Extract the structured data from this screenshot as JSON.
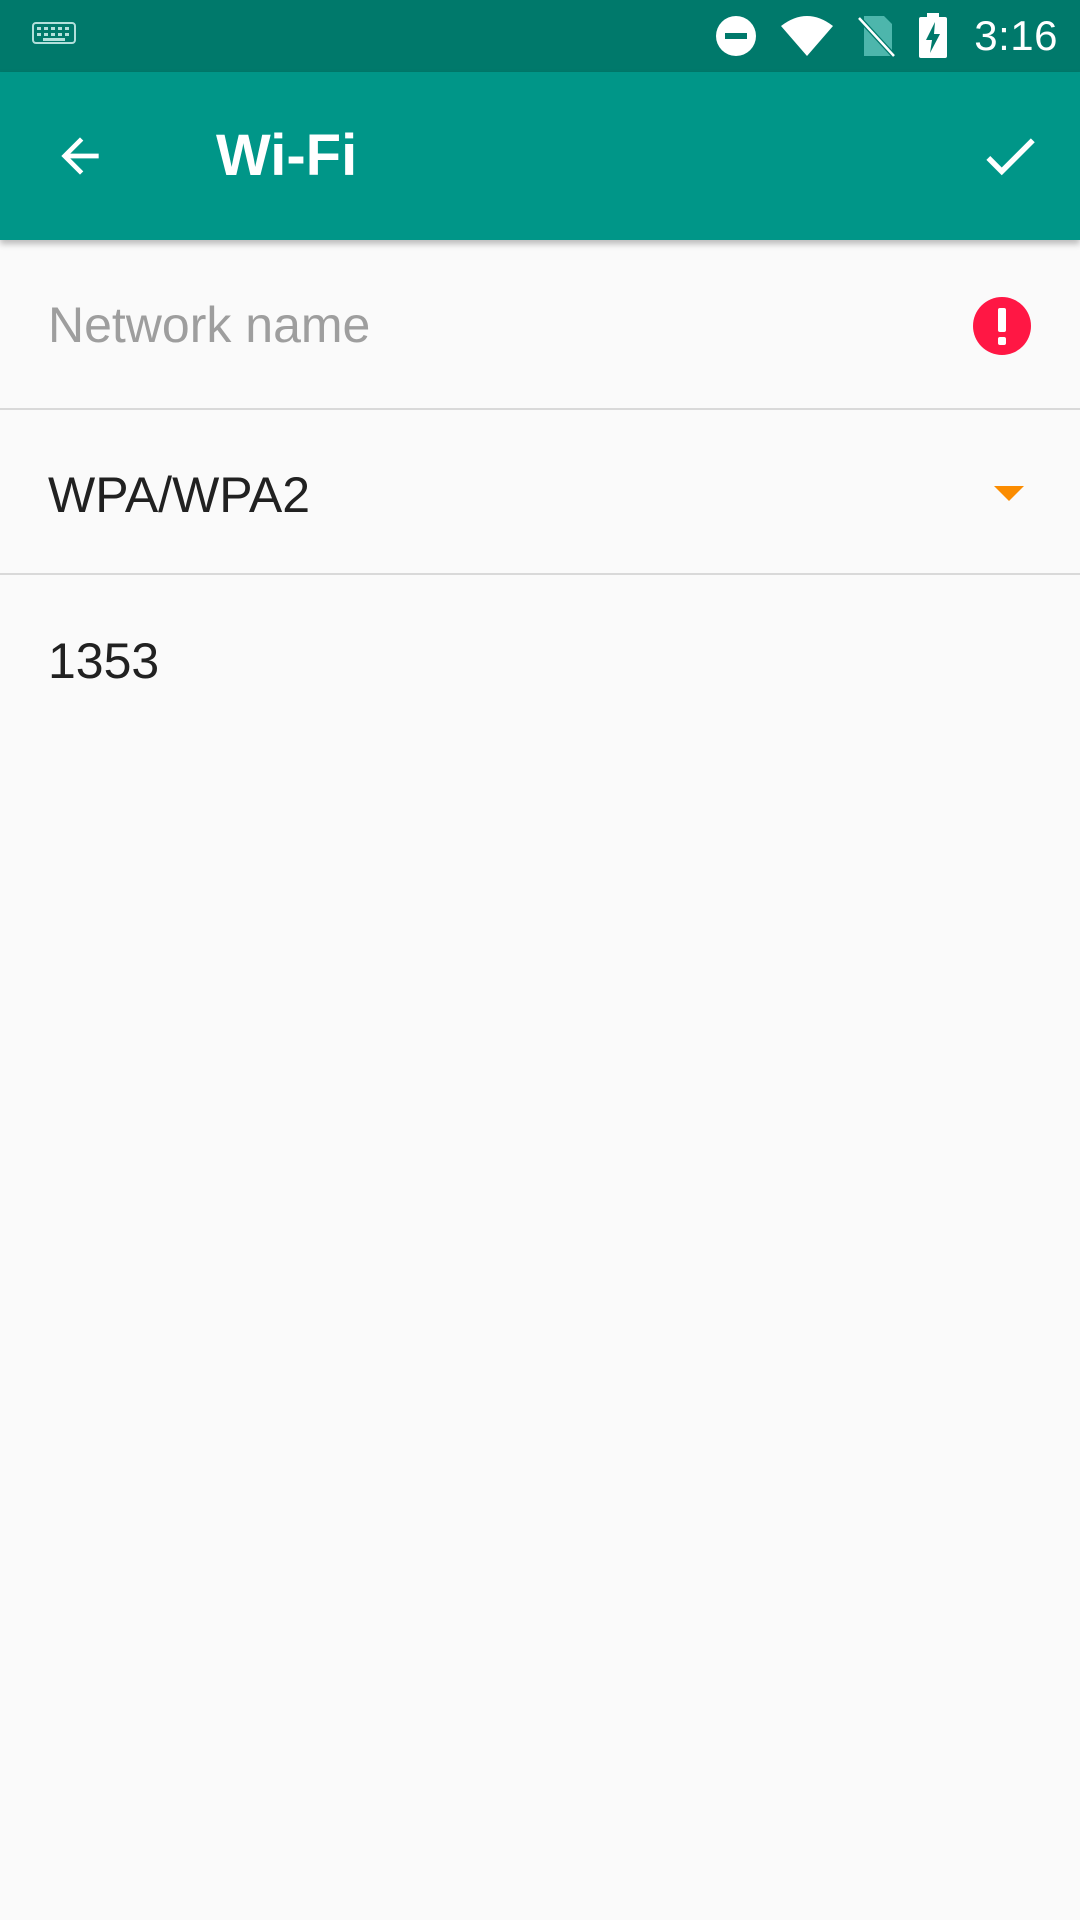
{
  "status_bar": {
    "time": "3:16",
    "icons": [
      "keyboard-icon",
      "do-not-disturb-icon",
      "wifi-icon",
      "no-sim-icon",
      "battery-charging-icon"
    ]
  },
  "app_bar": {
    "title": "Wi-Fi",
    "back_icon": "arrow-back-icon",
    "confirm_icon": "check-icon",
    "color": "#009688"
  },
  "form": {
    "network_name": {
      "placeholder": "Network name",
      "value": "",
      "error_icon": "error-icon",
      "error_color": "#ff1744"
    },
    "security": {
      "selected": "WPA/WPA2",
      "arrow_color": "#fb8c00"
    },
    "password": {
      "value": "1353"
    }
  }
}
